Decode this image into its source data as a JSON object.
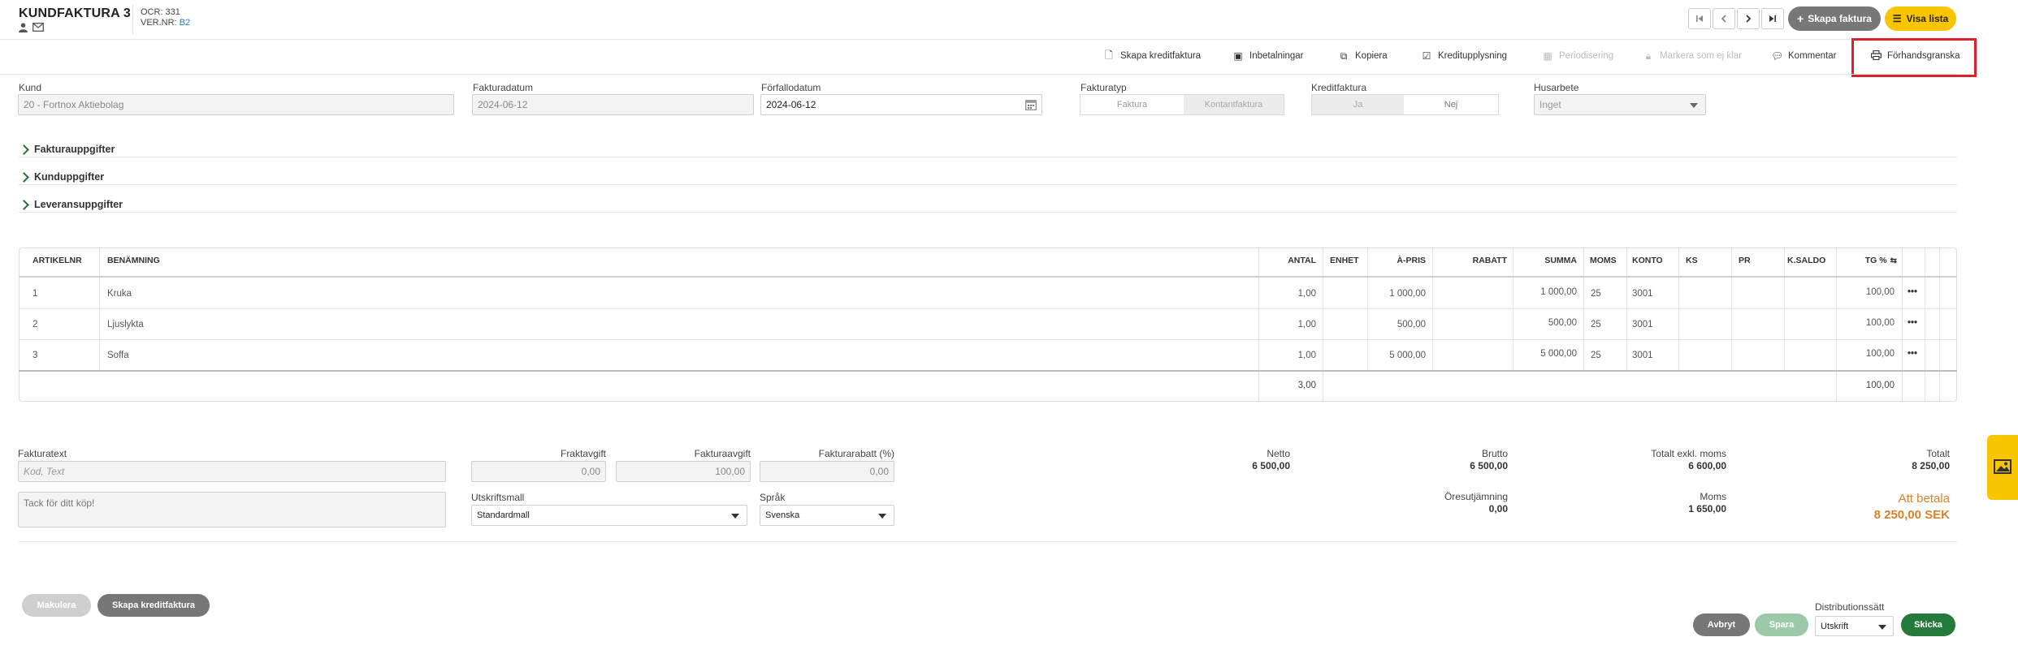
{
  "header": {
    "title": "KUNDFAKTURA 3",
    "ocr_label": "OCR: 331",
    "ver_prefix": "VER.NR: ",
    "ver_value": "B2",
    "nav": [
      "first",
      "prev",
      "next",
      "last"
    ],
    "create_invoice": "Skapa faktura",
    "show_list": "Visa lista"
  },
  "toolbar": {
    "items": [
      {
        "label": "Skapa kreditfaktura",
        "icon": "document-icon",
        "disabled": false
      },
      {
        "label": "Inbetalningar",
        "icon": "money-icon",
        "disabled": false
      },
      {
        "label": "Kopiera",
        "icon": "copy-icon",
        "disabled": false
      },
      {
        "label": "Kreditupplysning",
        "icon": "check-icon",
        "disabled": false
      },
      {
        "label": "Periodisering",
        "icon": "calendar-icon",
        "disabled": true
      },
      {
        "label": "Markera som ej klar",
        "icon": "lock-icon",
        "disabled": true
      },
      {
        "label": "Kommentar",
        "icon": "comment-icon",
        "disabled": false
      },
      {
        "label": "Förhandsgranska",
        "icon": "print-icon",
        "disabled": false
      }
    ]
  },
  "form": {
    "kund_label": "Kund",
    "kund_value": "20 - Fortnox Aktiebolag",
    "fakturadatum_label": "Fakturadatum",
    "fakturadatum_value": "2024-06-12",
    "forfallodatum_label": "Förfallodatum",
    "forfallodatum_value": "2024-06-12",
    "fakturatyp_label": "Fakturatyp",
    "fakturatyp_options": [
      "Faktura",
      "Kontantfaktura"
    ],
    "kreditfaktura_label": "Kreditfaktura",
    "kreditfaktura_options": [
      "Ja",
      "Nej"
    ],
    "husarbete_label": "Husarbete",
    "husarbete_value": "Inget"
  },
  "sections": [
    "Fakturauppgifter",
    "Kunduppgifter",
    "Leveransuppgifter"
  ],
  "table": {
    "headers": {
      "artikelnr": "ARTIKELNR",
      "benamning": "BENÄMNING",
      "antal": "ANTAL",
      "enhet": "ENHET",
      "apris": "À-PRIS",
      "rabatt": "RABATT",
      "summa": "SUMMA",
      "moms": "MOMS",
      "konto": "KONTO",
      "ks": "KS",
      "pr": "PR",
      "ksaldo": "K.SALDO",
      "tg": "TG %"
    },
    "rows": [
      {
        "artikelnr": "1",
        "benamning": "Kruka",
        "antal": "1,00",
        "apris": "1 000,00",
        "summa": "1 000,00",
        "moms": "25",
        "konto": "3001",
        "tg": "100,00"
      },
      {
        "artikelnr": "2",
        "benamning": "Ljuslykta",
        "antal": "1,00",
        "apris": "500,00",
        "summa": "500,00",
        "moms": "25",
        "konto": "3001",
        "tg": "100,00"
      },
      {
        "artikelnr": "3",
        "benamning": "Soffa",
        "antal": "1,00",
        "apris": "5 000,00",
        "summa": "5 000,00",
        "moms": "25",
        "konto": "3001",
        "tg": "100,00"
      }
    ],
    "footer": {
      "antal": "3,00",
      "tg": "100,00"
    }
  },
  "bottom": {
    "fakturatext_label": "Fakturatext",
    "fakturatext_placeholder": "Kod, Text",
    "fakturatext_value": "Tack för ditt köp!",
    "fraktavgift_label": "Fraktavgift",
    "fraktavgift_value": "0,00",
    "fakturaavgift_label": "Fakturaavgift",
    "fakturaavgift_value": "100,00",
    "fakturarabatt_label": "Fakturarabatt (%)",
    "fakturarabatt_value": "0,00",
    "utskriftsmall_label": "Utskriftsmall",
    "utskriftsmall_value": "Standardmall",
    "sprak_label": "Språk",
    "sprak_value": "Svenska"
  },
  "totals": {
    "netto_label": "Netto",
    "netto_value": "6 500,00",
    "brutto_label": "Brutto",
    "brutto_value": "6 500,00",
    "exkl_label": "Totalt exkl. moms",
    "exkl_value": "6 600,00",
    "totalt_label": "Totalt",
    "totalt_value": "8 250,00",
    "oresutjamning_label": "Öresutjämning",
    "oresutjamning_value": "0,00",
    "moms_label": "Moms",
    "moms_value": "1 650,00",
    "att_betala_label": "Att betala",
    "att_betala_value": "8 250,00 SEK"
  },
  "actions": {
    "makulera": "Makulera",
    "skapa_kreditfaktura": "Skapa kreditfaktura",
    "avbryt": "Avbryt",
    "spara": "Spara",
    "distribution_label": "Distributionssätt",
    "distribution_value": "Utskrift",
    "skicka": "Skicka"
  },
  "colors": {
    "accent_yellow": "#f9c500",
    "highlight_red": "#d9222a",
    "green": "#237a3b",
    "orange": "#d9822b"
  }
}
